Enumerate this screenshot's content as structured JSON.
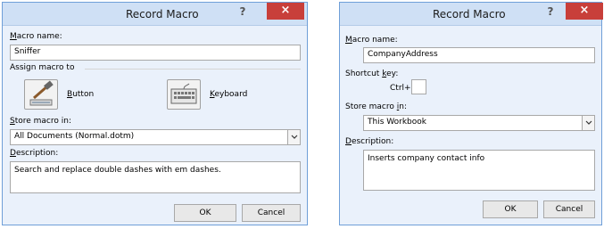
{
  "left": {
    "title": "Record Macro",
    "help": "?",
    "close": "×",
    "macro_name_label_u": "M",
    "macro_name_label_rest": "acro name:",
    "macro_name_value": "Sniffer",
    "assign_label": "Assign macro to",
    "button_label_u": "B",
    "button_label_rest": "utton",
    "keyboard_label_u": "K",
    "keyboard_label_rest": "eyboard",
    "store_label_u": "S",
    "store_label_rest": "tore macro in:",
    "store_value": "All Documents (Normal.dotm)",
    "description_label_u": "D",
    "description_label_rest": "escription:",
    "description_value": "Search and replace double dashes with em dashes.",
    "ok": "OK",
    "cancel": "Cancel"
  },
  "right": {
    "title": "Record Macro",
    "help": "?",
    "close": "×",
    "macro_name_label_u": "M",
    "macro_name_label_rest": "acro name:",
    "macro_name_value": "CompanyAddress",
    "shortcut_label_pre": "Shortcut ",
    "shortcut_label_u": "k",
    "shortcut_label_rest": "ey:",
    "ctrl_label": "Ctrl+",
    "store_label_pre": "Store macro ",
    "store_label_u": "i",
    "store_label_rest": "n:",
    "store_value": "This Workbook",
    "description_label_u": "D",
    "description_label_rest": "escription:",
    "description_value": "Inserts company contact info",
    "ok": "OK",
    "cancel": "Cancel"
  }
}
